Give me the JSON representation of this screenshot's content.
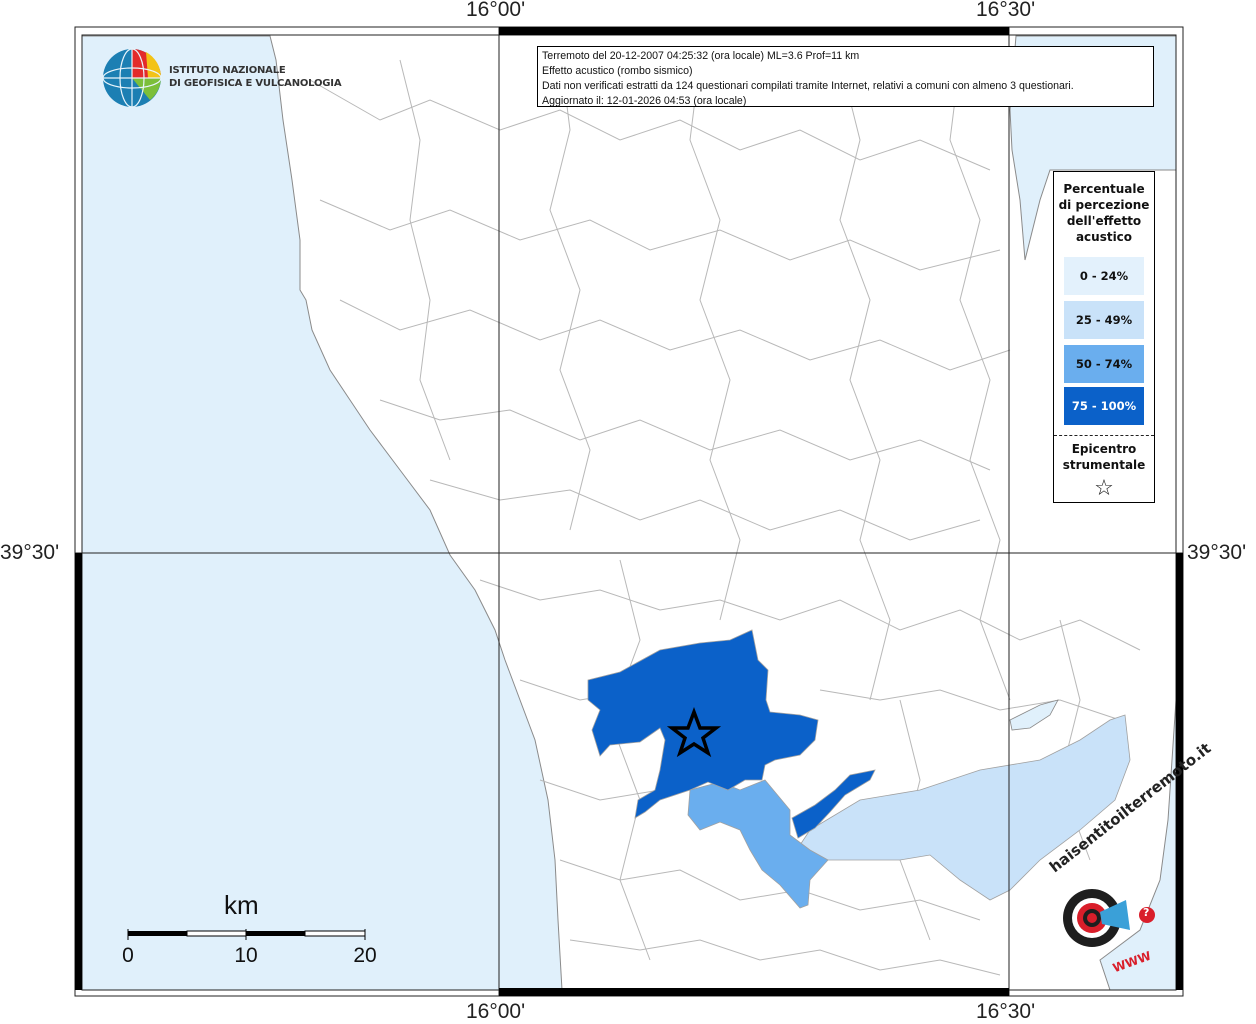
{
  "info": {
    "line1": "Terremoto del 20-12-2007 04:25:32 (ora locale) ML=3.6 Prof=11 km",
    "line2": "Effetto acustico (rombo sismico)",
    "line3": "Dati non verificati estratti da 124 questionari compilati tramite Internet, relativi a comuni con almeno 3 questionari.",
    "line4": "Aggiornato il: 12-01-2026 04:53 (ora locale)"
  },
  "institute": {
    "line1": "ISTITUTO NAZIONALE",
    "line2": "DI GEOFISICA E VULCANOLOGIA"
  },
  "legend": {
    "title": "Percentuale di percezione dell'effetto acustico",
    "classes": [
      {
        "label": "0 - 24%",
        "color": "#e3f1fc",
        "text_color": "#111111"
      },
      {
        "label": "25 - 49%",
        "color": "#c9e2f9",
        "text_color": "#111111"
      },
      {
        "label": "50 - 74%",
        "color": "#6aaeee",
        "text_color": "#111111"
      },
      {
        "label": "75 - 100%",
        "color": "#0b61c9",
        "text_color": "#ffffff"
      }
    ],
    "epicentre_label": "Epicentro strumentale",
    "epicentre_symbol": "☆"
  },
  "coords": {
    "top_left": "16°00'",
    "top_right": "16°30'",
    "bottom_left": "16°00'",
    "bottom_right": "16°30'",
    "left_lat": "39°30'",
    "right_lat": "39°30'"
  },
  "scale": {
    "unit": "km",
    "ticks": [
      "0",
      "10",
      "20"
    ]
  },
  "brand": {
    "name": "haisentitoilterremoto.it",
    "www": "WWW",
    "question": "?"
  },
  "colors": {
    "sea": "#e0f0fb",
    "land": "#ffffff",
    "boundary": "#b5b5b5",
    "coast": "#8a8a8a",
    "epicentre": "#000000"
  }
}
